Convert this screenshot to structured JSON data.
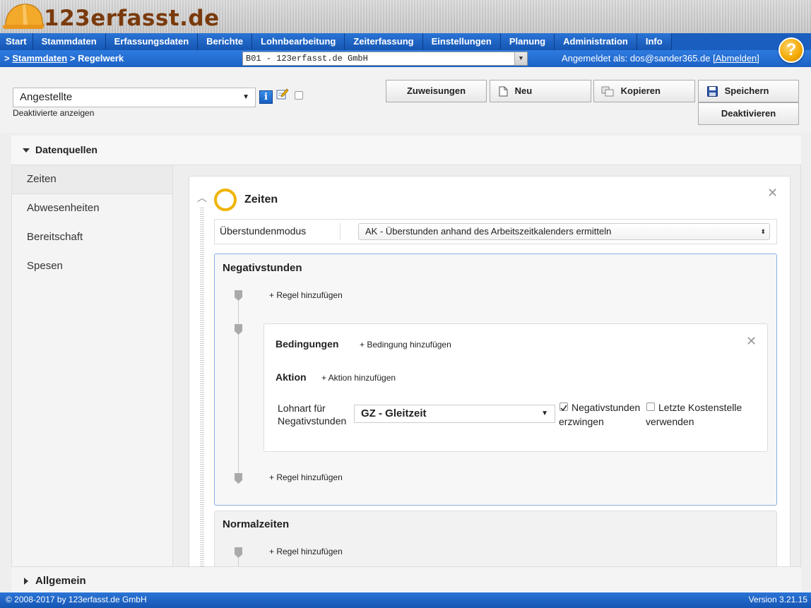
{
  "header": {
    "logo_text": "123erfasst.de"
  },
  "nav": {
    "items": [
      "Start",
      "Stammdaten",
      "Erfassungsdaten",
      "Berichte",
      "Lohnbearbeitung",
      "Zeiterfassung",
      "Einstellungen",
      "Planung",
      "Administration",
      "Info"
    ]
  },
  "subnav": {
    "breadcrumb_prefix": ">",
    "breadcrumb_link": "Stammdaten",
    "breadcrumb_current": "> Regelwerk",
    "tenant": "B01 - 123erfasst.de GmbH",
    "login_label": "Angemeldet als: dos@sander365.de",
    "logout": "[Abmelden]",
    "help": "?"
  },
  "toolbar": {
    "type_value": "Angestellte",
    "show_deactivated": "Deaktivierte anzeigen",
    "info": "i",
    "zuweisungen": "Zuweisungen",
    "neu": "Neu",
    "kopieren": "Kopieren",
    "speichern": "Speichern",
    "deaktivieren": "Deaktivieren"
  },
  "panel": {
    "title": "Datenquellen",
    "sidebar": [
      "Zeiten",
      "Abwesenheiten",
      "Bereitschaft",
      "Spesen"
    ],
    "allgemein": "Allgemein"
  },
  "zeiten": {
    "title": "Zeiten",
    "mode_label": "Überstundenmodus",
    "mode_value": "AK - Überstunden anhand des Arbeitszeitkalenders ermitteln",
    "negativ": {
      "title": "Negativstunden",
      "add_rule": "+ Regel hinzufügen",
      "conditions": "Bedingungen",
      "add_condition": "+ Bedingung hinzufügen",
      "action": "Aktion",
      "add_action": "+ Aktion hinzufügen",
      "lohnart_label_1": "Lohnart für",
      "lohnart_label_2": "Negativstunden",
      "lohnart_value": "GZ - Gleitzeit",
      "force_label_1": "Negativstunden",
      "force_label_2": "erzwingen",
      "force_checked": true,
      "last_cost_label_1": "Letzte Kostenstelle",
      "last_cost_label_2": "verwenden",
      "last_cost_checked": false
    },
    "normal": {
      "title": "Normalzeiten",
      "add_rule": "+ Regel hinzufügen"
    }
  },
  "footer": {
    "copyright": "© 2008-2017 by 123erfasst.de GmbH",
    "version": "Version 3.21.15"
  },
  "colors": {
    "nav_blue": "#1a5fc0",
    "accent_yellow": "#f0b400",
    "logo_brown": "#7a3a0c"
  }
}
